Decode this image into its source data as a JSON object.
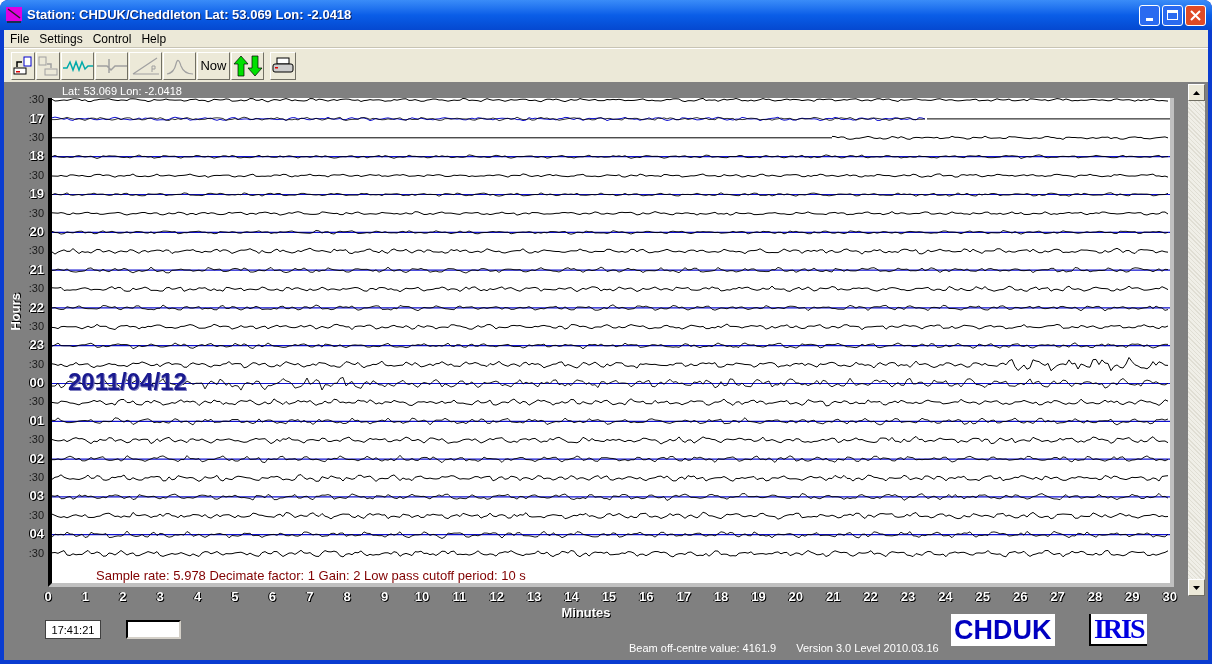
{
  "window": {
    "title": "Station: CHDUK/Cheddleton Lat: 53.069 Lon: -2.0418"
  },
  "menu": [
    "File",
    "Settings",
    "Control",
    "Help"
  ],
  "toolbar": [
    {
      "kind": "open",
      "disabled": false
    },
    {
      "kind": "copy",
      "disabled": true
    },
    {
      "kind": "wave",
      "disabled": false
    },
    {
      "kind": "cross",
      "disabled": true
    },
    {
      "kind": "ramp",
      "disabled": true
    },
    {
      "kind": "peak",
      "disabled": true
    },
    {
      "kind": "text",
      "label": "Now",
      "disabled": false
    },
    {
      "kind": "arrows",
      "disabled": false
    },
    {
      "kind": "print",
      "disabled": false
    }
  ],
  "plot": {
    "coordinates": "Lat: 53.069 Lon: -2.0418",
    "date": "2011/04/12",
    "info": "Sample rate: 5.978  Decimate factor: 1  Gain: 2  Low pass cutoff period: 10 s",
    "y_title": "Hours",
    "x_title": "Minutes",
    "rows": [
      {
        "label": ":30",
        "kind": "half"
      },
      {
        "label": "17",
        "kind": "hour"
      },
      {
        "label": ":30",
        "kind": "half"
      },
      {
        "label": "18",
        "kind": "hour"
      },
      {
        "label": ":30",
        "kind": "half"
      },
      {
        "label": "19",
        "kind": "hour"
      },
      {
        "label": ":30",
        "kind": "half"
      },
      {
        "label": "20",
        "kind": "hour"
      },
      {
        "label": ":30",
        "kind": "half"
      },
      {
        "label": "21",
        "kind": "hour"
      },
      {
        "label": ":30",
        "kind": "half"
      },
      {
        "label": "22",
        "kind": "hour"
      },
      {
        "label": ":30",
        "kind": "half"
      },
      {
        "label": "23",
        "kind": "hour"
      },
      {
        "label": ":30",
        "kind": "half"
      },
      {
        "label": "00",
        "kind": "hour"
      },
      {
        "label": ":30",
        "kind": "half"
      },
      {
        "label": "01",
        "kind": "hour"
      },
      {
        "label": ":30",
        "kind": "half"
      },
      {
        "label": "02",
        "kind": "hour"
      },
      {
        "label": ":30",
        "kind": "half"
      },
      {
        "label": "03",
        "kind": "hour"
      },
      {
        "label": ":30",
        "kind": "half"
      },
      {
        "label": "04",
        "kind": "hour"
      },
      {
        "label": ":30",
        "kind": "half"
      }
    ],
    "x_labels": [
      "0",
      "1",
      "2",
      "3",
      "4",
      "5",
      "6",
      "7",
      "8",
      "9",
      "10",
      "11",
      "12",
      "13",
      "14",
      "15",
      "16",
      "17",
      "18",
      "19",
      "20",
      "21",
      "22",
      "23",
      "24",
      "25",
      "26",
      "27",
      "28",
      "29",
      "30"
    ]
  },
  "status": {
    "time": "17:41:21",
    "beam": "Beam off-centre value: 4161.9",
    "version": "Version 3.0 Level 2010.03.16",
    "station_logo": "CHDUK",
    "network_logo": "IRIS"
  }
}
